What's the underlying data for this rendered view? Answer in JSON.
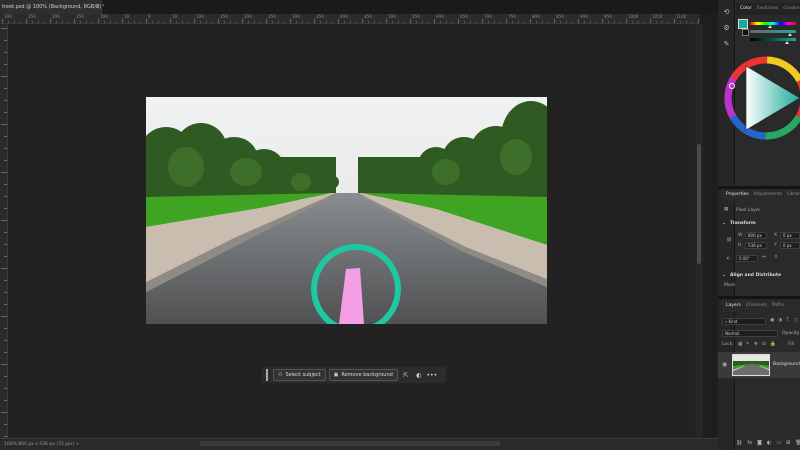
{
  "document": {
    "tab_title": "treet.psd @ 100% (Background, RGB/8) *",
    "close_glyph": "×"
  },
  "ruler": {
    "labels": [
      "300",
      "250",
      "200",
      "150",
      "100",
      "50",
      "0",
      "50",
      "100",
      "150",
      "200",
      "250",
      "300",
      "350",
      "400",
      "450",
      "500",
      "550",
      "600",
      "650",
      "700",
      "750",
      "800",
      "850",
      "900",
      "950",
      "1000",
      "1050",
      "1100",
      "1150"
    ]
  },
  "status_bar": {
    "text": "100%      800 px x 536 px (72 ppi)    >"
  },
  "taskbar": {
    "select_subject": "Select subject",
    "remove_background": "Remove background",
    "more": "•••"
  },
  "panels": {
    "color_tabs": [
      "Color",
      "Swatches",
      "Gradients",
      "Pa"
    ],
    "properties_tabs": [
      "Properties",
      "Adjustments",
      "Librar"
    ],
    "pixel_layer": "Pixel Layer",
    "transform_label": "Transform",
    "w_label": "W",
    "w_value": "800 px",
    "h_label": "H",
    "h_value": "536 px",
    "x_label": "X",
    "x_value": "0 px",
    "y_label": "Y",
    "y_value": "0 px",
    "angle_value": "0.00°",
    "align_label": "Align and Distribute",
    "more_label": "More",
    "layers_tabs": [
      "Layers",
      "Channels",
      "Paths"
    ],
    "kind_value": "Kind",
    "blend_value": "Normal",
    "opacity_label": "Opacity",
    "lock_label": "Lock:",
    "fill_label": "Fill",
    "layer_name": "Background"
  },
  "colors": {
    "accent_circle": "#1ec8a0",
    "highlight_stroke": "#f49ee8",
    "foreground_swatch": "#1aa998"
  }
}
